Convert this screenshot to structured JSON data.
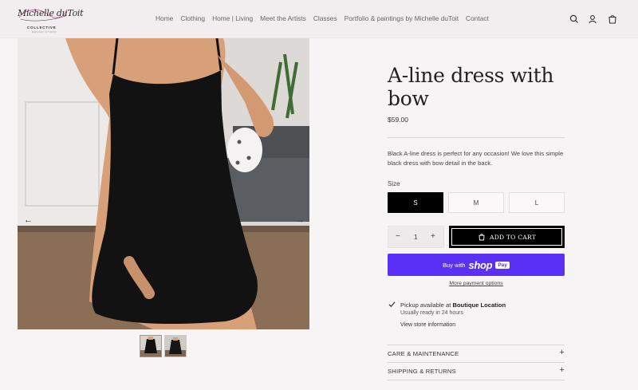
{
  "header": {
    "logo": {
      "script_text": "Michelle duToit",
      "collective": "COLLECTIVE",
      "tagline": "DESIGN STUDIO"
    },
    "nav": [
      "Home",
      "Clothing",
      "Home | Living",
      "Meet the Artists",
      "Classes",
      "Portfolio & paintings by Michelle duToit",
      "Contact"
    ],
    "icons": [
      "search-icon",
      "account-icon",
      "cart-icon"
    ]
  },
  "gallery": {
    "prev": "←",
    "next": "→",
    "thumbnails": 2
  },
  "product": {
    "title": "A-line dress with bow",
    "price": "$59.00",
    "description": "Black A-line dress is perfect for any occasion! We love this simple black dress with bow detail in the back.",
    "size_label": "Size",
    "sizes": [
      "S",
      "M",
      "L"
    ],
    "selected_size": "S",
    "quantity": "1",
    "qty_minus": "−",
    "qty_plus": "+",
    "add_to_cart": "ADD TO CART",
    "shop_pay": {
      "prefix": "Buy with",
      "brand": "shop",
      "badge": "Pay"
    },
    "more_payment": "More payment options",
    "pickup": {
      "prefix": "Pickup available at ",
      "location": "Boutique Location",
      "ready": "Usually ready in 24 hours",
      "store_link": "View store information"
    },
    "accordions": [
      "CARE & MAINTENANCE",
      "SHIPPING & RETURNS"
    ],
    "accordion_icon": "+"
  },
  "colors": {
    "accent": "#000000",
    "shop_pay": "#5a31f4",
    "background": "#f7f4f5"
  }
}
